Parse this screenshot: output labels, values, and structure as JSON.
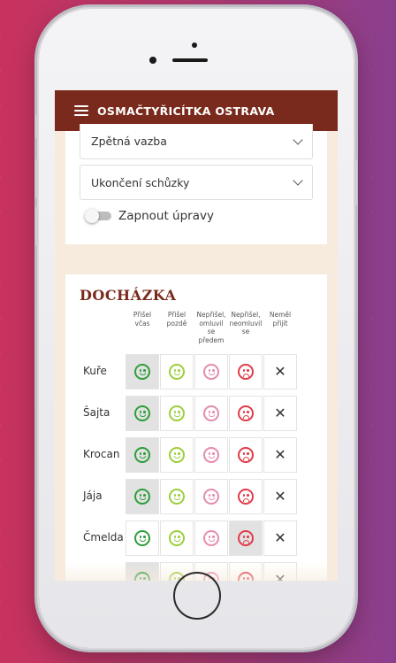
{
  "app": {
    "title": "OSMAČTYŘICÍTKA OSTRAVA"
  },
  "accordion": [
    {
      "label": "Zpětná vazba"
    },
    {
      "label": "Ukončení schůzky"
    }
  ],
  "toggle": {
    "label": "Zapnout úpravy",
    "on": false
  },
  "attendance": {
    "title": "DOCHÁZKA",
    "columns": [
      {
        "label": "Přišel včas",
        "icon": "face-happy-icon",
        "color": "#2e9e3a"
      },
      {
        "label": "Přišel pozdě",
        "icon": "face-happy-icon",
        "color": "#9ccf3d"
      },
      {
        "label": "Nepřišel, omluvil se předem",
        "icon": "face-happy-icon",
        "color": "#e58bb1"
      },
      {
        "label": "Nepřišel, neomluvil se",
        "icon": "face-sad-icon",
        "color": "#e23b4a"
      },
      {
        "label": "Neměl přijít",
        "icon": "close-icon",
        "color": "#333333"
      }
    ],
    "rows": [
      {
        "name": "Kuře",
        "selected": 0
      },
      {
        "name": "Šajta",
        "selected": 0
      },
      {
        "name": "Krocan",
        "selected": 0
      },
      {
        "name": "Jája",
        "selected": 0
      },
      {
        "name": "Čmelda",
        "selected": 3
      },
      {
        "name": "",
        "selected": 0
      }
    ]
  },
  "colors": {
    "header": "#7a2a1c",
    "page_bg": "#f6ebdd"
  }
}
